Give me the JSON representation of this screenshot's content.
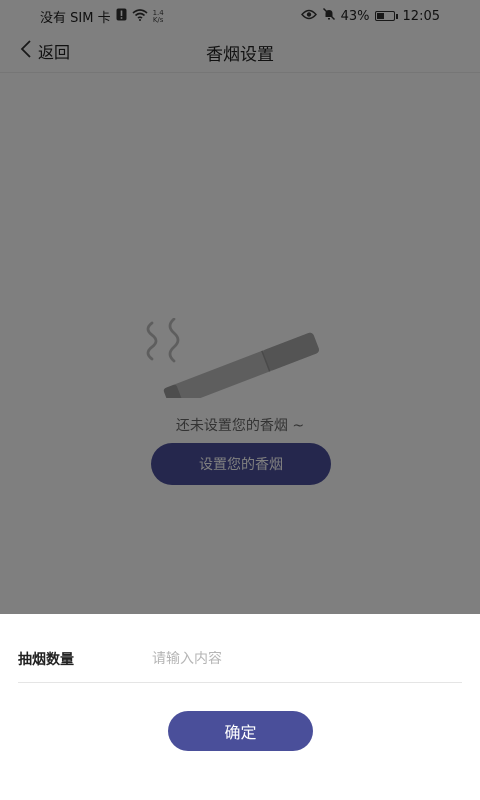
{
  "status_bar": {
    "carrier": "没有 SIM 卡",
    "net_speed_value": "1.4",
    "net_speed_unit": "K/s",
    "battery_percent": "43%",
    "battery_level": 0.43,
    "time": "12:05"
  },
  "nav": {
    "back_label": "返回",
    "title": "香烟设置"
  },
  "empty_state": {
    "message": "还未设置您的香烟 ~",
    "button_label": "设置您的香烟"
  },
  "sheet": {
    "field_label": "抽烟数量",
    "field_placeholder": "请输入内容",
    "field_value": "",
    "confirm_label": "确定"
  },
  "colors": {
    "accent": "#4a4f9a",
    "overlay": "rgba(0,0,0,0.5)"
  },
  "icons": [
    "sim-alert-icon",
    "wifi-icon",
    "eye-icon",
    "mute-bell-icon",
    "battery-icon",
    "back-chevron-icon",
    "cigarette-illustration"
  ]
}
